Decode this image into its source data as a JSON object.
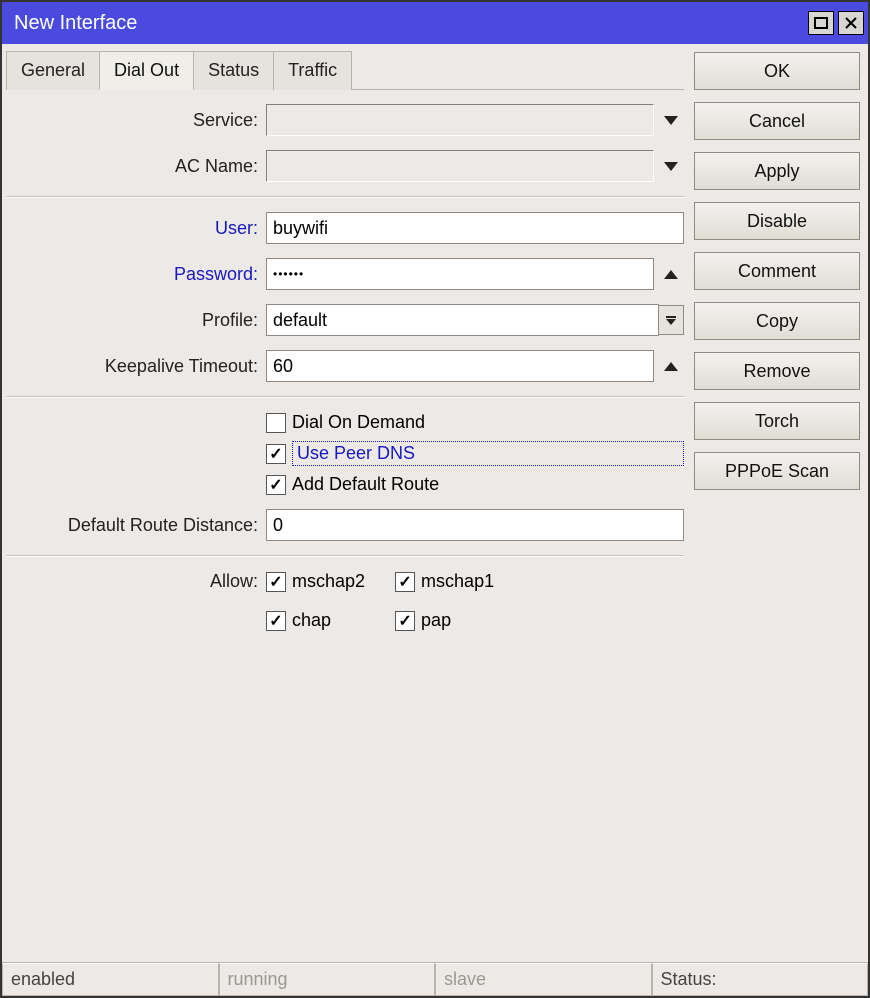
{
  "titlebar": {
    "title": "New Interface"
  },
  "tabs": {
    "general": "General",
    "dial_out": "Dial Out",
    "status": "Status",
    "traffic": "Traffic",
    "active": "dial_out"
  },
  "form": {
    "service_label": "Service:",
    "service_value": "",
    "ac_name_label": "AC Name:",
    "ac_name_value": "",
    "user_label": "User:",
    "user_value": "buywifi",
    "password_label": "Password:",
    "password_value": "••••••",
    "profile_label": "Profile:",
    "profile_value": "default",
    "keepalive_label": "Keepalive Timeout:",
    "keepalive_value": "60",
    "dial_on_demand_label": "Dial On Demand",
    "dial_on_demand_checked": false,
    "use_peer_dns_label": "Use Peer DNS",
    "use_peer_dns_checked": true,
    "add_default_route_label": "Add Default Route",
    "add_default_route_checked": true,
    "default_route_distance_label": "Default Route Distance:",
    "default_route_distance_value": "0",
    "allow_label": "Allow:",
    "allow": {
      "mschap2": {
        "label": "mschap2",
        "checked": true
      },
      "mschap1": {
        "label": "mschap1",
        "checked": true
      },
      "chap": {
        "label": "chap",
        "checked": true
      },
      "pap": {
        "label": "pap",
        "checked": true
      }
    }
  },
  "actions": {
    "ok": "OK",
    "cancel": "Cancel",
    "apply": "Apply",
    "disable": "Disable",
    "comment": "Comment",
    "copy": "Copy",
    "remove": "Remove",
    "torch": "Torch",
    "pppoe_scan": "PPPoE Scan"
  },
  "status": {
    "enabled": "enabled",
    "running": "running",
    "slave": "slave",
    "status_label": "Status:"
  }
}
